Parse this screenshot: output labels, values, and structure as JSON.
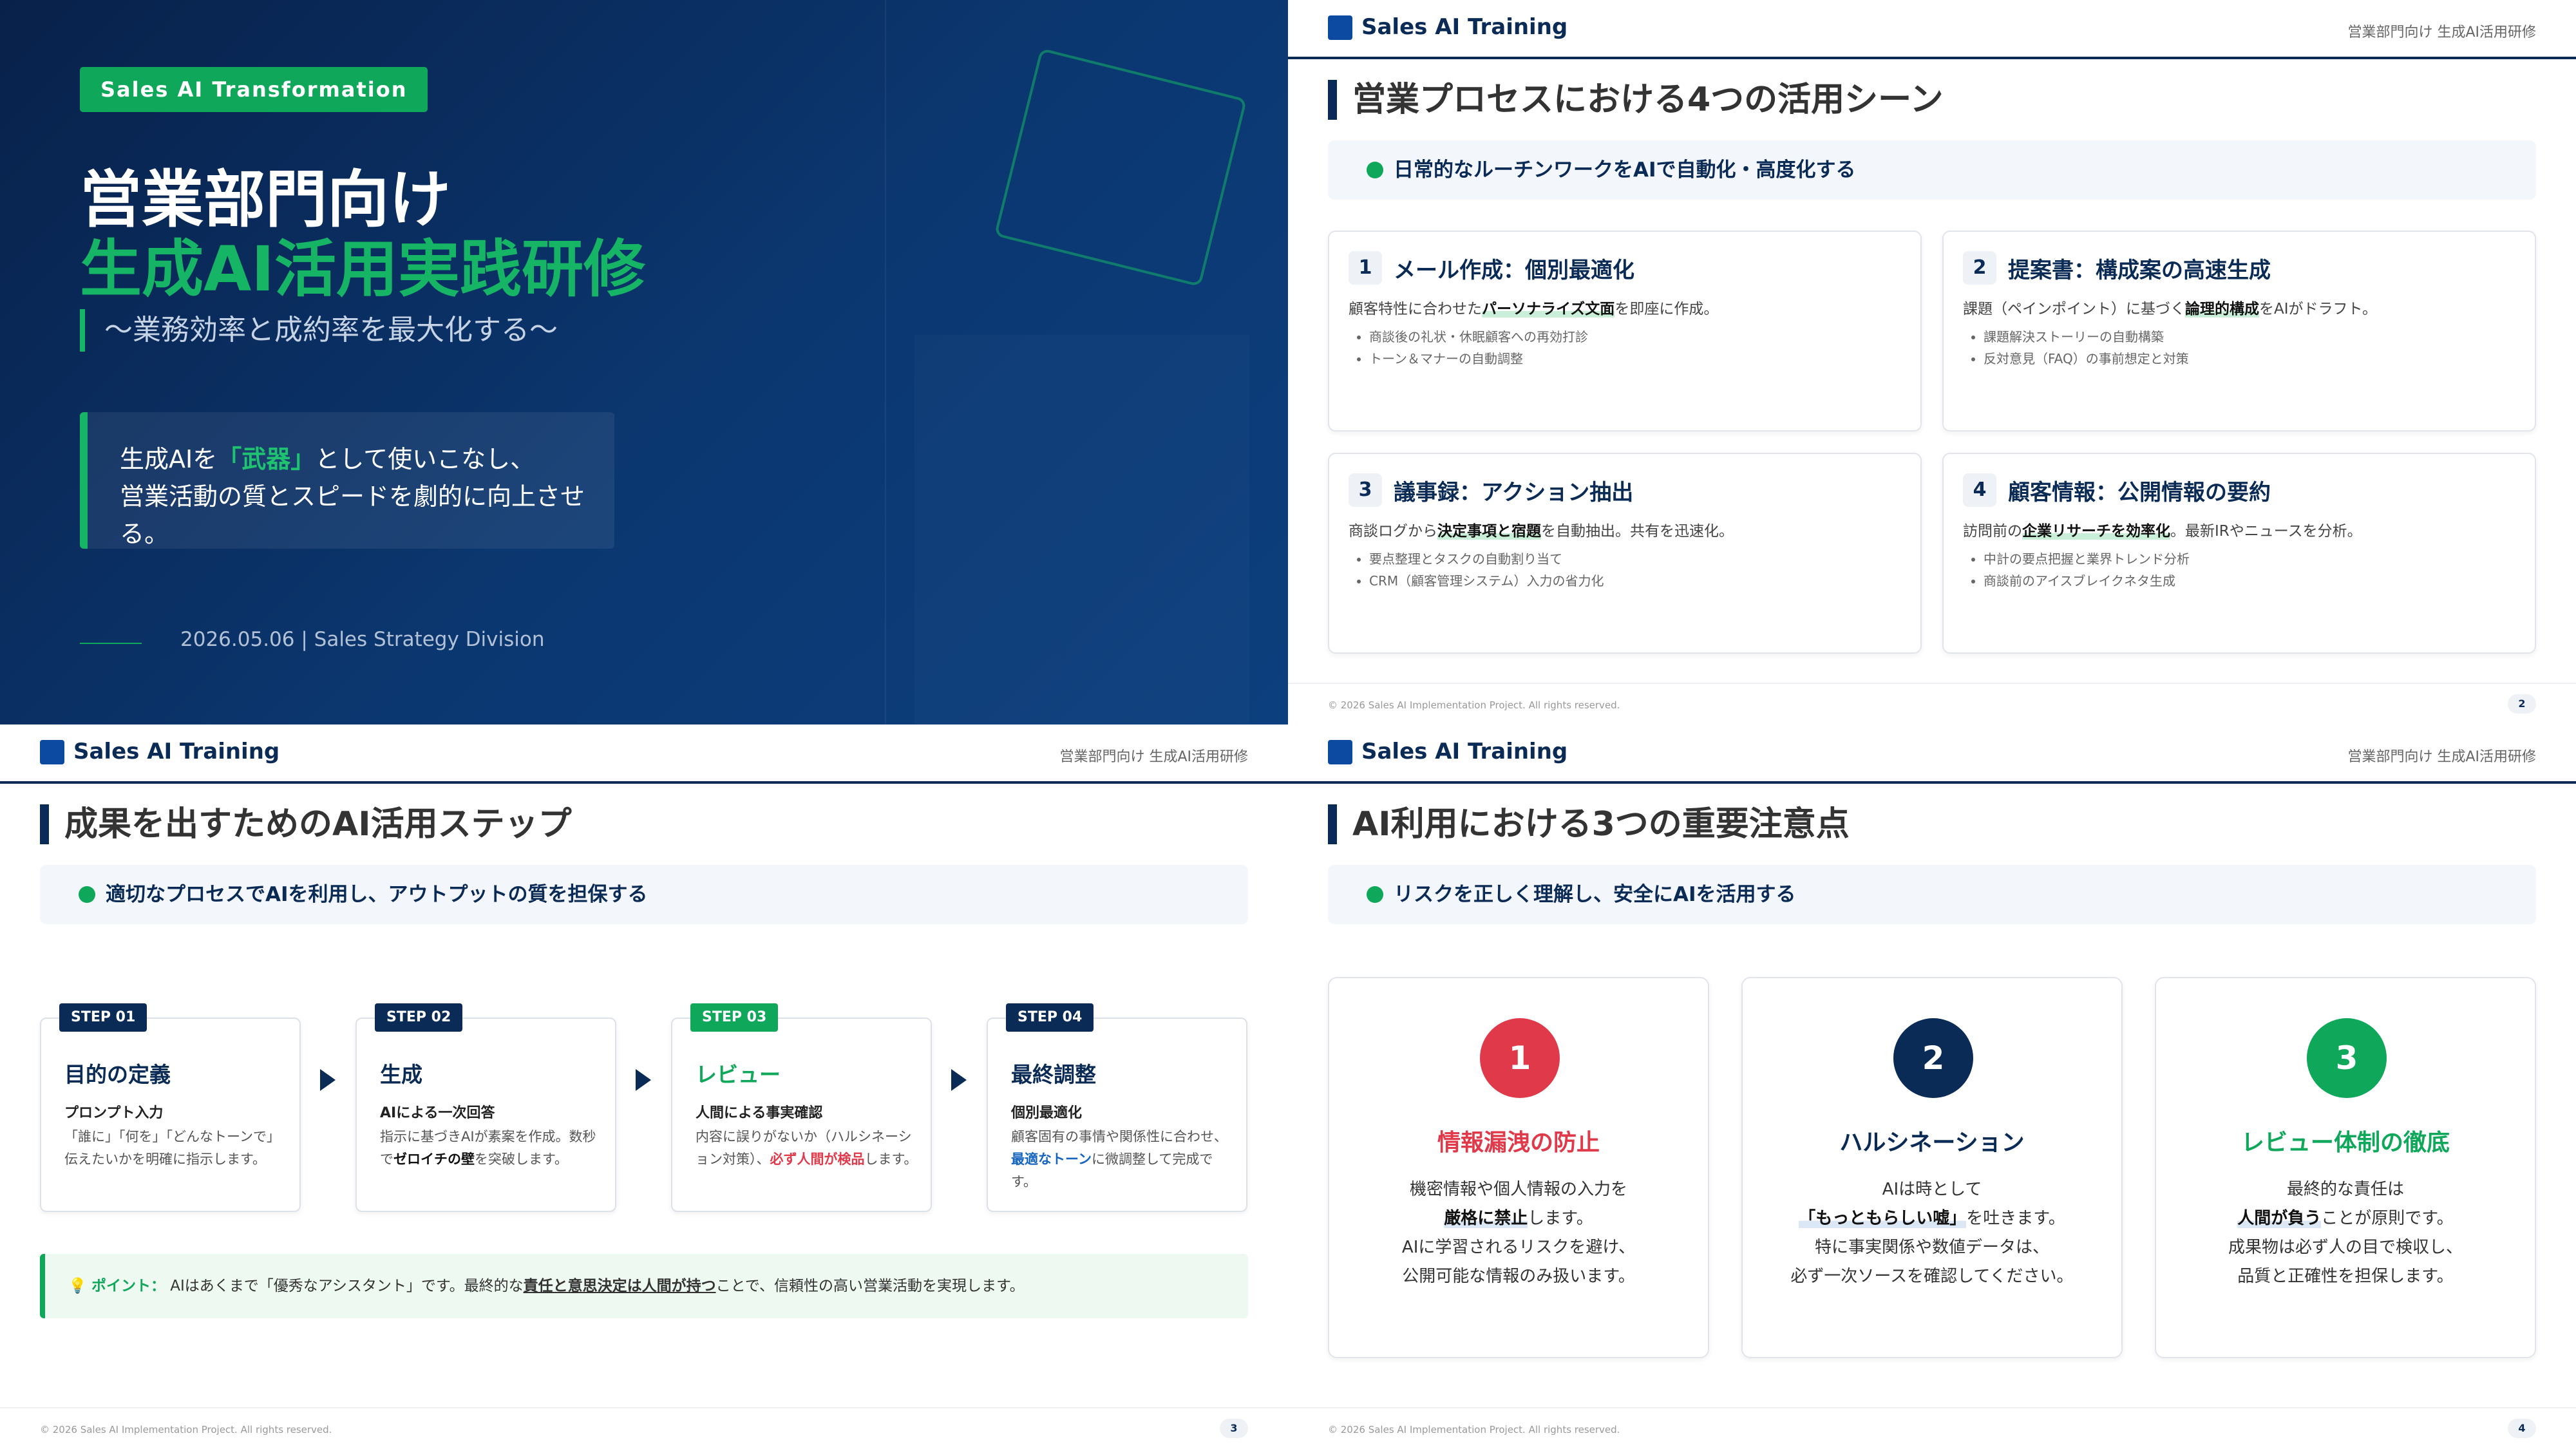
{
  "slide1": {
    "badge": "Sales AI Transformation",
    "title_line1": "営業部門向け",
    "title_line2": "生成AI活用実践研修",
    "subtitle": "〜業務効率と成約率を最大化する〜",
    "message": {
      "pre": "生成AIを",
      "highlight": "「武器」",
      "post": "として使いこなし、",
      "line2": "営業活動の質とスピードを劇的に向上させる。"
    },
    "date_line": "2026.05.06 | Sales Strategy Division"
  },
  "header": {
    "brand": "Sales AI Training",
    "right": "営業部門向け 生成AI活用研修"
  },
  "footer": {
    "copyright": "© 2026 Sales AI Implementation Project. All rights reserved."
  },
  "slide2": {
    "title": "営業プロセスにおける4つの活用シーン",
    "lead": "日常的なルーチンワークをAIで自動化・高度化する",
    "page": "2",
    "cards": [
      {
        "num": "1",
        "title": "メール作成：個別最適化",
        "desc_pre": "顧客特性に合わせた",
        "desc_bold": "パーソナライズ文面",
        "desc_post": "を即座に作成。",
        "bullets": [
          "商談後の礼状・休眠顧客への再効打診",
          "トーン＆マナーの自動調整"
        ]
      },
      {
        "num": "2",
        "title": "提案書：構成案の高速生成",
        "desc_pre": "課題（ペインポイント）に基づく",
        "desc_bold": "論理的構成",
        "desc_post": "をAIがドラフト。",
        "bullets": [
          "課題解決ストーリーの自動構築",
          "反対意見（FAQ）の事前想定と対策"
        ]
      },
      {
        "num": "3",
        "title": "議事録：アクション抽出",
        "desc_pre": "商談ログから",
        "desc_bold": "決定事項と宿題",
        "desc_post": "を自動抽出。共有を迅速化。",
        "bullets": [
          "要点整理とタスクの自動割り当て",
          "CRM（顧客管理システム）入力の省力化"
        ]
      },
      {
        "num": "4",
        "title": "顧客情報：公開情報の要約",
        "desc_pre": "訪問前の",
        "desc_bold": "企業リサーチを効率化",
        "desc_post": "。最新IRやニュースを分析。",
        "bullets": [
          "中計の要点把握と業界トレンド分析",
          "商談前のアイスブレイクネタ生成"
        ]
      }
    ]
  },
  "slide3": {
    "title": "成果を出すためのAI活用ステップ",
    "lead": "適切なプロセスでAIを利用し、アウトプットの質を担保する",
    "page": "3",
    "steps": [
      {
        "badge": "STEP 01",
        "title": "目的の定義",
        "sub": "プロンプト入力",
        "desc_pre": "「誰に」「何を」「どんなトーンで」伝えたいかを明確に指示します。",
        "desc_em": "",
        "desc_post": ""
      },
      {
        "badge": "STEP 02",
        "title": "生成",
        "sub": "AIによる一次回答",
        "desc_pre": "指示に基づきAIが素案を作成。数秒で",
        "desc_em": "ゼロイチの壁",
        "desc_post": "を突破します。"
      },
      {
        "badge": "STEP 03",
        "title": "レビュー",
        "sub": "人間による事実確認",
        "desc_pre": "内容に誤りがないか（ハルシネーション対策）、",
        "desc_em": "必ず人間が検品",
        "desc_post": "します。"
      },
      {
        "badge": "STEP 04",
        "title": "最終調整",
        "sub": "個別最適化",
        "desc_pre": "顧客固有の事情や関係性に合わせ、",
        "desc_em": "最適なトーン",
        "desc_post": "に微調整して完成です。"
      }
    ],
    "point": {
      "icon": "💡",
      "label": "ポイント：",
      "pre": "AIはあくまで「優秀なアシスタント」です。最終的な",
      "underline": "責任と意思決定は人間が持つ",
      "post": "ことで、信頼性の高い営業活動を実現します。"
    }
  },
  "slide4": {
    "title": "AI利用における3つの重要注意点",
    "lead": "リスクを正しく理解し、安全にAIを活用する",
    "page": "4",
    "cards": [
      {
        "num": "1",
        "title": "情報漏洩の防止",
        "line1": "機密情報や個人情報の入力を",
        "bold": "厳格に禁止",
        "after_bold": "します。",
        "line3": "AIに学習されるリスクを避け、",
        "line4": "公開可能な情報のみ扱います。"
      },
      {
        "num": "2",
        "title": "ハルシネーション",
        "line1": "AIは時として",
        "bold": "「もっともらしい嘘」",
        "after_bold": "を吐きます。",
        "line3": "特に事実関係や数値データは、",
        "line4": "必ず一次ソースを確認してください。"
      },
      {
        "num": "3",
        "title": "レビュー体制の徹底",
        "line1": "最終的な責任は",
        "bold": "人間が負う",
        "after_bold": "ことが原則です。",
        "line3": "成果物は必ず人の目で検収し、",
        "line4": "品質と正確性を担保します。"
      }
    ]
  },
  "colors": {
    "navy": "#0b2b57",
    "green": "#0fa85a",
    "red": "#e03a4a",
    "blue": "#1565c0"
  }
}
